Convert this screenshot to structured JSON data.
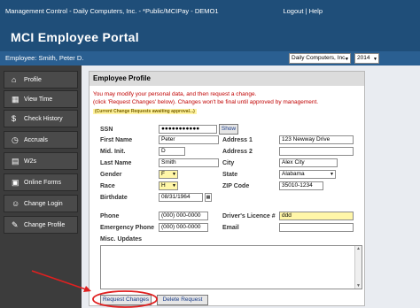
{
  "window": {
    "title": "Management Control - Daily Computers, Inc. - *Public/MCIPay - DEMO1",
    "logout": "Logout",
    "separator": "|",
    "help": "Help"
  },
  "banner": {
    "title": "MCI Employee Portal"
  },
  "employee_bar": {
    "label": "Employee: Smith, Peter D.",
    "company_select": "Daily Computers, Inc.",
    "year_select": "2014"
  },
  "sidebar": {
    "items": [
      {
        "label": "Profile",
        "icon": "home-icon"
      },
      {
        "label": "View Time",
        "icon": "calendar-icon"
      },
      {
        "label": "Check History",
        "icon": "money-bag-icon"
      },
      {
        "label": "Accruals",
        "icon": "clock-icon"
      },
      {
        "label": "W2s",
        "icon": "document-icon"
      },
      {
        "label": "Online Forms",
        "icon": "forms-icon"
      },
      {
        "label": "Change Login",
        "icon": "person-icon"
      },
      {
        "label": "Change Profile",
        "icon": "person-edit-icon"
      }
    ]
  },
  "profile": {
    "heading": "Employee Profile",
    "msg1": "You may modify your personal data, and then request a change.",
    "msg2": "(click 'Request Changes' below). Changes won't be final until approved by management.",
    "pending_note": "(Current Change Requests awaiting approval...)",
    "ssn_label": "SSN",
    "ssn_value": "●●●●●●●●●●●",
    "show_button": "Show",
    "first_name_label": "First Name",
    "first_name_value": "Peter",
    "mid_init_label": "Mid. Init.",
    "mid_init_value": "D",
    "last_name_label": "Last Name",
    "last_name_value": "Smith",
    "gender_label": "Gender",
    "gender_value": "F",
    "race_label": "Race",
    "race_value": "H",
    "birthdate_label": "Birthdate",
    "birthdate_value": "08/31/1964",
    "address1_label": "Address 1",
    "address1_value": "123 Newway Drive",
    "address2_label": "Address 2",
    "address2_value": "",
    "city_label": "City",
    "city_value": "Alex City",
    "state_label": "State",
    "state_value": "Alabama",
    "zip_label": "ZIP Code",
    "zip_value": "35010-1234",
    "phone_label": "Phone",
    "phone_value": "(000) 000-0000",
    "emergency_phone_label": "Emergency Phone",
    "emergency_phone_value": "(000) 000-0000",
    "drivers_licence_label": "Driver's Licence #",
    "drivers_licence_value": "ddd",
    "email_label": "Email",
    "email_value": "",
    "misc_label": "Misc. Updates",
    "misc_value": "",
    "request_changes": "Request Changes",
    "delete_request": "Delete Request"
  },
  "colors": {
    "header_blue": "#1f4e79",
    "sidebar_dark": "#3c3c3c",
    "warning_red": "#c00000",
    "highlight_yellow": "#fff6a8",
    "annotation_red": "#e02020"
  }
}
